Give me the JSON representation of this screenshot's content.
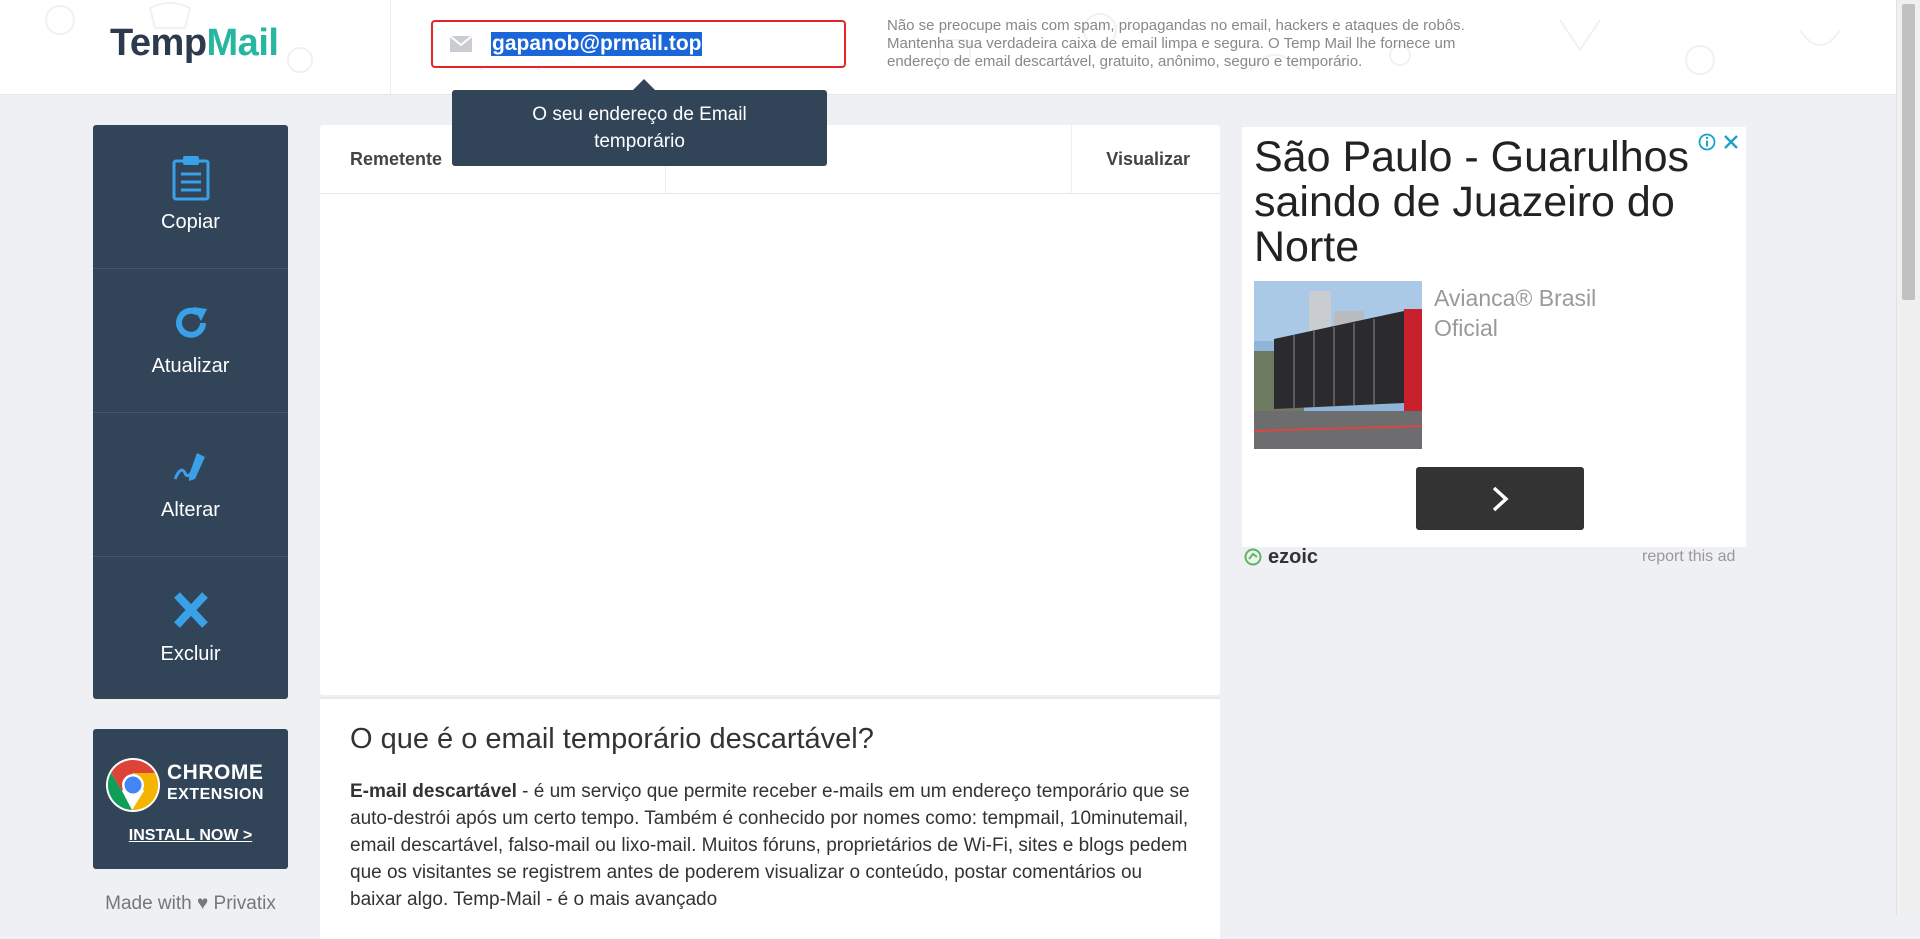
{
  "header": {
    "logo": {
      "part1": "Temp",
      "part2": "Mail"
    },
    "email_address": "gapanob@prmail.top",
    "description": "Não se preocupe mais com spam, propagandas no email, hackers e ataques de robôs. Mantenha sua verdadeira caixa de email limpa e segura. O Temp Mail lhe fornece um endereço de email descartável, gratuito, anônimo, seguro e temporário."
  },
  "tooltip": {
    "line1": "O seu endereço de Email",
    "line2": "temporário"
  },
  "sidebar": {
    "items": [
      {
        "label": "Copiar",
        "icon": "clipboard-icon"
      },
      {
        "label": "Atualizar",
        "icon": "refresh-icon"
      },
      {
        "label": "Alterar",
        "icon": "edit-icon"
      },
      {
        "label": "Excluir",
        "icon": "delete-icon"
      }
    ],
    "chrome_extension": {
      "title": "CHROME",
      "subtitle": "EXTENSION",
      "link": "INSTALL NOW >"
    },
    "made_with": "Made with ♥ Privatix"
  },
  "inbox": {
    "columns": {
      "sender": "Remetente",
      "view": "Visualizar"
    }
  },
  "article": {
    "title": "O que é o email temporário descartável?",
    "lead_bold": "E-mail descartável",
    "body": " - é um serviço que permite receber e-mails em um endereço temporário que se auto-destrói após um certo tempo. Também é conhecido por nomes como: tempmail, 10minutemail, email descartável, falso-mail ou lixo-mail. Muitos fóruns, proprietários de Wi-Fi, sites e blogs pedem que os visitantes se registrem antes de poderem visualizar o conteúdo, postar comentários ou baixar algo. Temp-Mail - é o mais avançado"
  },
  "ad": {
    "headline": "São Paulo - Guarulhos saindo de Juazeiro do Norte",
    "advertiser": "Avianca® Brasil Oficial",
    "brand": "ezoic",
    "report": "report this ad"
  },
  "colors": {
    "sidebar_bg": "#324458",
    "icon_blue": "#3aa0e8",
    "logo_dark": "#2b3a4d",
    "logo_teal": "#27b7a0",
    "highlight": "#1a66d9",
    "email_border": "#e8242b"
  }
}
